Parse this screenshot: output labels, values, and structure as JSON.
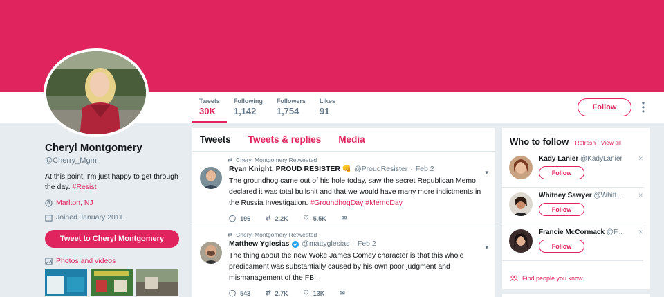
{
  "colors": {
    "accent": "#e0245e",
    "muted": "#657786",
    "background": "#e6ecf0"
  },
  "profile": {
    "name": "Cheryl Montgomery",
    "handle": "@Cherry_Mgm",
    "bio_text": "At this point, I'm just happy to get through the day.",
    "bio_hashtag": "#Resist",
    "location": "Marlton, NJ",
    "joined": "Joined January 2011",
    "tweet_to_label": "Tweet to Cheryl Montgomery",
    "photos_label": "Photos and videos"
  },
  "stats": [
    {
      "label": "Tweets",
      "value": "30K"
    },
    {
      "label": "Following",
      "value": "1,142"
    },
    {
      "label": "Followers",
      "value": "1,754"
    },
    {
      "label": "Likes",
      "value": "91"
    }
  ],
  "follow_label": "Follow",
  "tabs": [
    "Tweets",
    "Tweets & replies",
    "Media"
  ],
  "tweets": [
    {
      "retweet_label": "Cheryl Montgomery Retweeted",
      "name": "Ryan Knight, PROUD RESISTER 👊",
      "handle": "@ProudResister",
      "date": "Feb 2",
      "text": "The groundhog came out of his hole today, saw the secret Republican Memo, declared it was total bullshit and that we would have many more indictments in the Russia Investigation.",
      "hashtags": "#GroundhogDay #MemoDay",
      "replies": "196",
      "retweets": "2.2K",
      "likes": "5.5K"
    },
    {
      "retweet_label": "Cheryl Montgomery Retweeted",
      "name": "Matthew Yglesias",
      "handle": "@mattyglesias",
      "date": "Feb 2",
      "text": "The thing about the new Woke James Comey character is that this whole predicament was substantially caused by his own poor judgment and mismanagement of the FBI.",
      "hashtags": "",
      "replies": "543",
      "retweets": "2.7K",
      "likes": "13K"
    }
  ],
  "who_to_follow": {
    "title": "Who to follow",
    "links": "· Refresh · View all",
    "suggestions": [
      {
        "name": "Kady Lanier",
        "handle": "@KadyLanier",
        "button": "Follow"
      },
      {
        "name": "Whitney Sawyer",
        "handle": "@Whitt...",
        "button": "Follow"
      },
      {
        "name": "Francie McCormack",
        "handle": "@F...",
        "button": "Follow"
      }
    ],
    "find_label": "Find people you know"
  }
}
